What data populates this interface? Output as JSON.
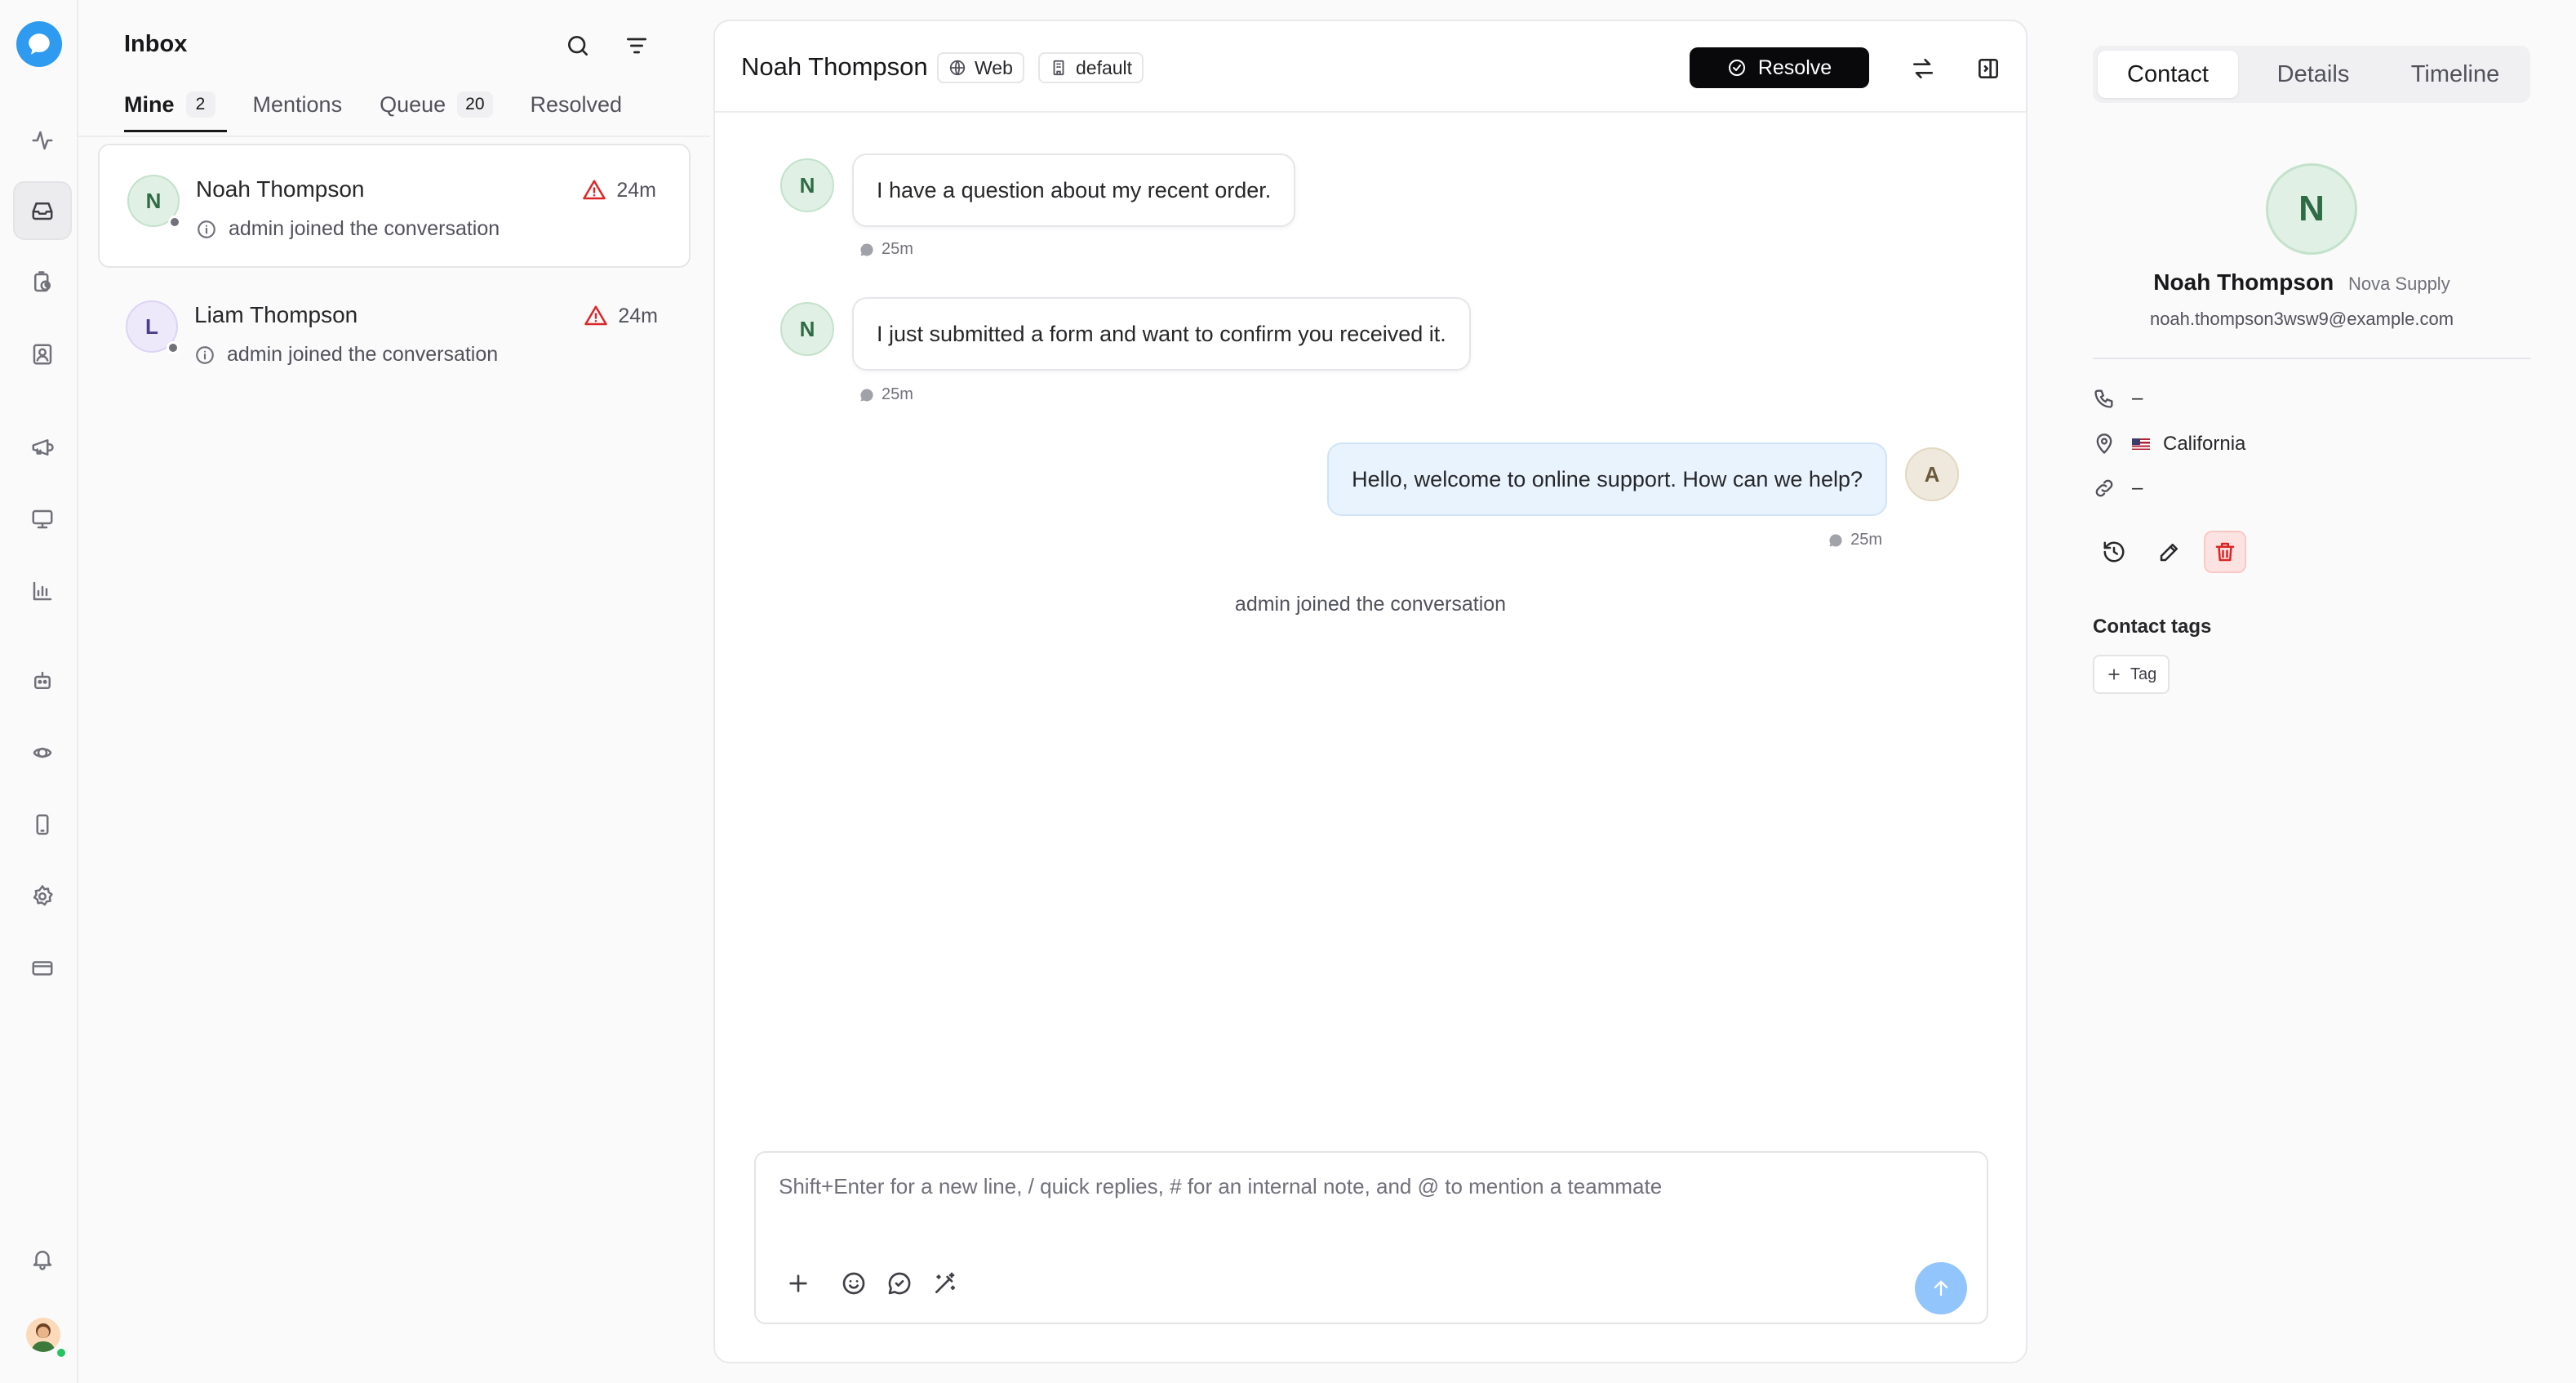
{
  "inbox": {
    "title": "Inbox",
    "tabs": [
      {
        "label": "Mine",
        "count": "2"
      },
      {
        "label": "Mentions",
        "count": ""
      },
      {
        "label": "Queue",
        "count": "20"
      },
      {
        "label": "Resolved",
        "count": ""
      }
    ],
    "conversations": [
      {
        "initial": "N",
        "name": "Noah Thompson",
        "time": "24m",
        "preview": "admin joined the conversation",
        "avatar_bg": "#e0f0e4",
        "avatar_fg": "#2f6b45"
      },
      {
        "initial": "L",
        "name": "Liam Thompson",
        "time": "24m",
        "preview": "admin joined the conversation",
        "avatar_bg": "#ede9fa",
        "avatar_fg": "#4b3f8a"
      }
    ]
  },
  "chat": {
    "contact_name": "Noah Thompson",
    "channel": "Web",
    "inbox_name": "default",
    "resolve_label": "Resolve",
    "messages": [
      {
        "initial": "N",
        "text": "I have a question about my recent order.",
        "time": "25m"
      },
      {
        "initial": "N",
        "text": "I just submitted a form and want to confirm you received it.",
        "time": "25m"
      },
      {
        "initial": "A",
        "text": "Hello, welcome to online support. How can we help?",
        "time": "25m"
      }
    ],
    "system_message": "admin joined the conversation",
    "composer_placeholder": "Shift+Enter for a new line, / quick replies, # for an internal note, and @ to mention a teammate"
  },
  "contact": {
    "tabs": [
      "Contact",
      "Details",
      "Timeline"
    ],
    "initial": "N",
    "name": "Noah Thompson",
    "company": "Nova Supply",
    "email": "noah.thompson3wsw9@example.com",
    "phone": "–",
    "location": "California",
    "website": "–",
    "tags_title": "Contact tags",
    "tag_button": "Tag"
  },
  "colors": {
    "brand": "#2e9bf0",
    "resolve_button": "#09090b",
    "outgoing_bubble": "#e8f3fd",
    "alert": "#dc2626",
    "send_button": "#93c5fd",
    "online": "#22c55e"
  },
  "icons": {
    "rail": [
      "activity-icon",
      "inbox-icon",
      "clock-icon",
      "contacts-icon",
      "campaigns-icon",
      "monitor-icon",
      "reports-icon",
      "bot-icon",
      "integrations-icon",
      "mobile-icon",
      "settings-icon",
      "billing-icon",
      "bell-icon"
    ]
  }
}
